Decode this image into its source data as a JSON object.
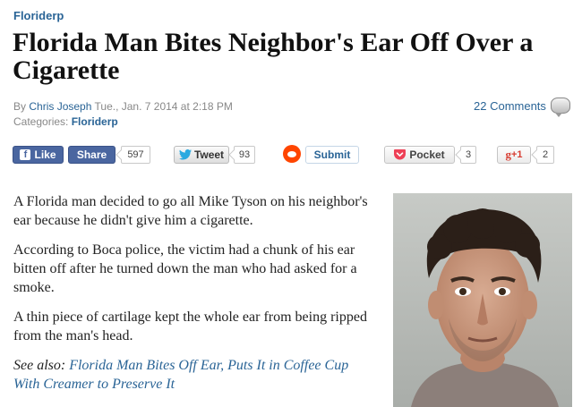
{
  "category": "Floriderp",
  "headline": "Florida Man Bites Neighbor's Ear Off Over a Cigarette",
  "byline": {
    "prefix": "By",
    "author": "Chris Joseph",
    "date": "Tue., Jan. 7 2014 at 2:18 PM",
    "categories_label": "Categories:",
    "categories_value": "Floriderp"
  },
  "comments": {
    "label": "22 Comments",
    "icon": "comment-bubble-icon"
  },
  "social": {
    "like_label": "Like",
    "share_label": "Share",
    "share_count": "597",
    "tweet_label": "Tweet",
    "tweet_count": "93",
    "submit_label": "Submit",
    "pocket_label": "Pocket",
    "pocket_count": "3",
    "gplus_label": "+1",
    "gplus_count": "2"
  },
  "article": {
    "paragraphs": [
      "A Florida man decided to go all Mike Tyson on his neighbor's ear because he didn't give him a cigarette.",
      "According to Boca police, the victim had a chunk of his ear bitten off after he turned down the man who had asked for a smoke.",
      "A thin piece of cartilage kept the whole ear from being ripped from the man's head."
    ],
    "see_also_label": "See also:",
    "see_also_link": "Florida Man Bites Off Ear, Puts It in Coffee Cup With Creamer to Preserve It"
  },
  "colors": {
    "link": "#2a6496",
    "facebook": "#4a66a0",
    "reddit": "#ff4500",
    "pocket": "#ee4056",
    "gplus": "#d73d32"
  }
}
